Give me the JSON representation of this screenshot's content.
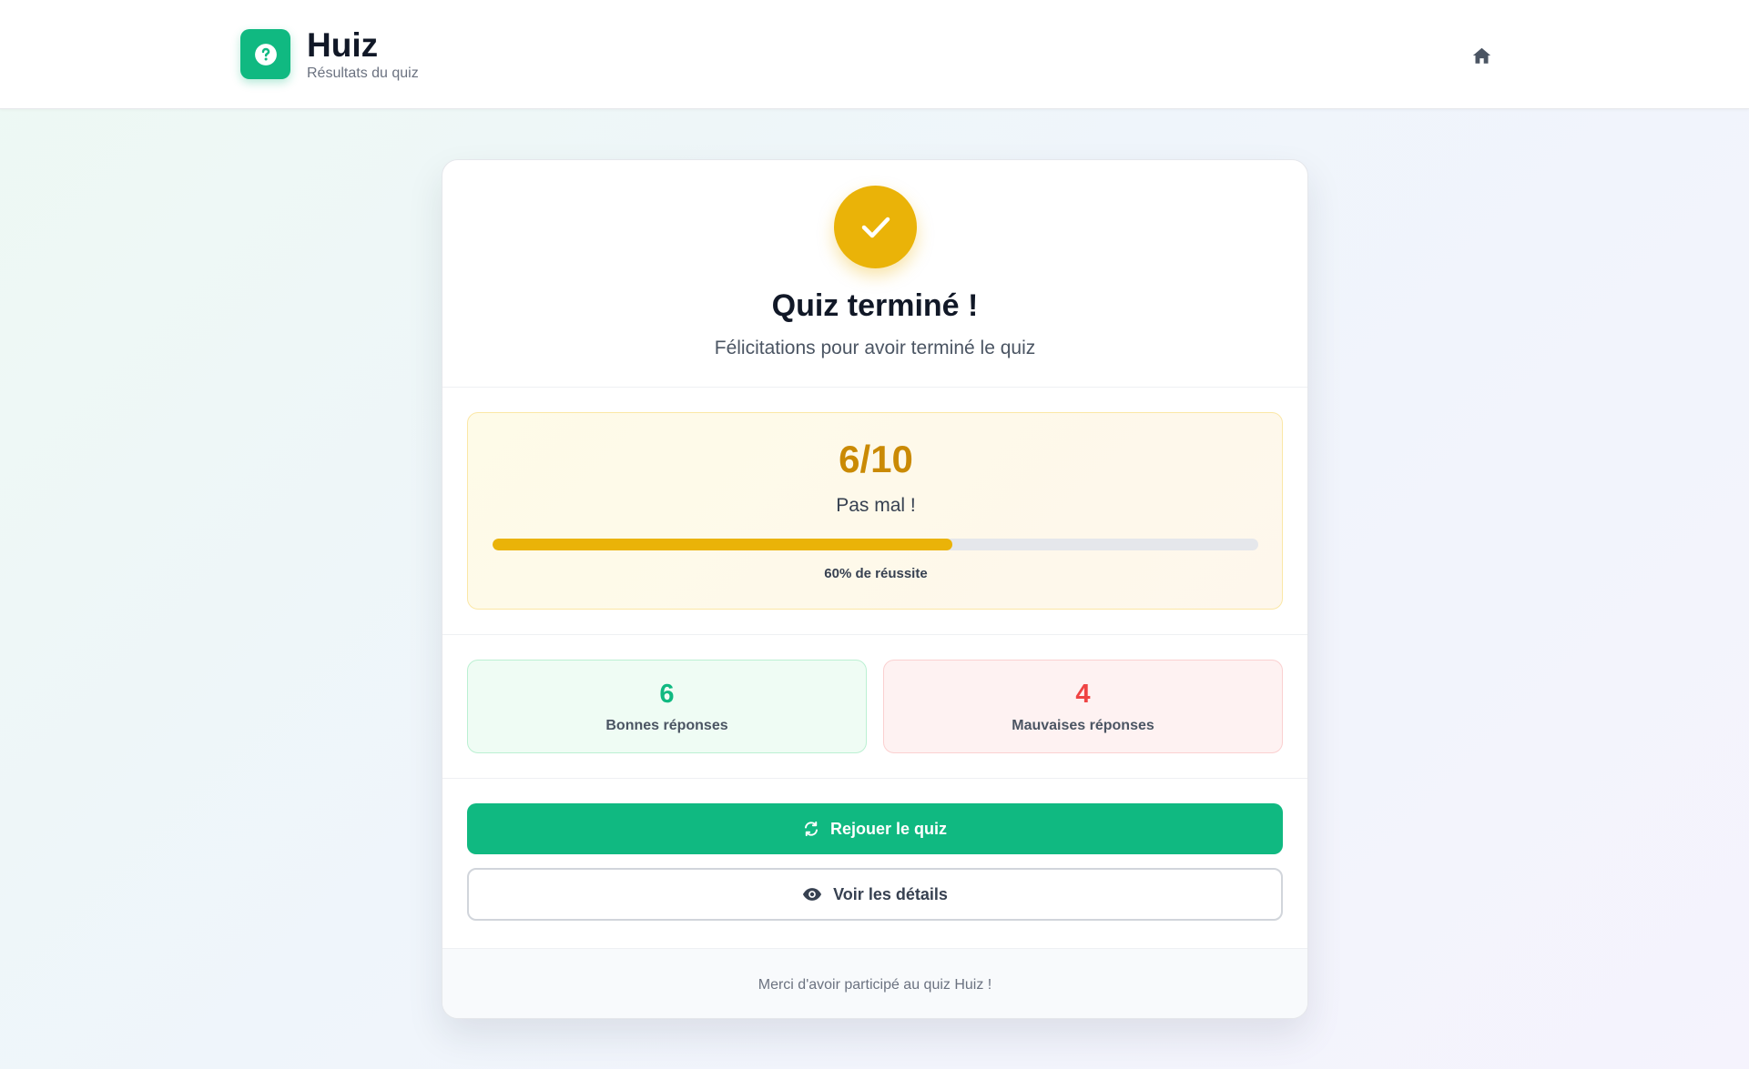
{
  "header": {
    "brand": "Huiz",
    "subtitle": "Résultats du quiz",
    "logo_icon": "question-circle-icon",
    "home_icon": "home-icon"
  },
  "result": {
    "status_icon": "check-icon",
    "title": "Quiz terminé !",
    "message": "Félicitations pour avoir terminé le quiz"
  },
  "score": {
    "value": "6/10",
    "label": "Pas mal !",
    "progress_percent": 60,
    "progress_text": "60% de réussite"
  },
  "stats": {
    "correct": {
      "value": "6",
      "label": "Bonnes réponses"
    },
    "wrong": {
      "value": "4",
      "label": "Mauvaises réponses"
    }
  },
  "actions": {
    "replay_label": "Rejouer le quiz",
    "replay_icon": "refresh-icon",
    "details_label": "Voir les détails",
    "details_icon": "eye-icon"
  },
  "footer": {
    "text": "Merci d'avoir participé au quiz Huiz !"
  },
  "colors": {
    "brand": "#10b981",
    "accent": "#eab308",
    "score": "#ca8a04",
    "wrong": "#ef4444"
  }
}
